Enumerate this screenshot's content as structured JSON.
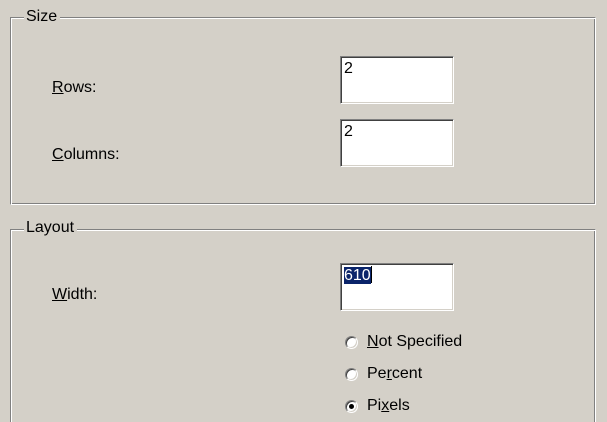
{
  "size_group": {
    "title": "Size",
    "rows_label_prefix": "",
    "rows_label_mnemonic": "R",
    "rows_label_rest": "ows:",
    "rows_value": "2",
    "columns_label_mnemonic": "C",
    "columns_label_rest": "olumns:",
    "columns_value": "2"
  },
  "layout_group": {
    "title": "Layout",
    "width_label_mnemonic": "W",
    "width_label_rest": "idth:",
    "width_value": "610",
    "width_unit_options": [
      {
        "pre": "",
        "mnemonic": "N",
        "post": "ot Specified",
        "checked": false
      },
      {
        "pre": "Pe",
        "mnemonic": "r",
        "post": "cent",
        "checked": false
      },
      {
        "pre": "Pi",
        "mnemonic": "x",
        "post": "els",
        "checked": true
      }
    ]
  },
  "colors": {
    "dialog_background": "#d4d0c8",
    "selection_highlight": "#0a246a"
  }
}
